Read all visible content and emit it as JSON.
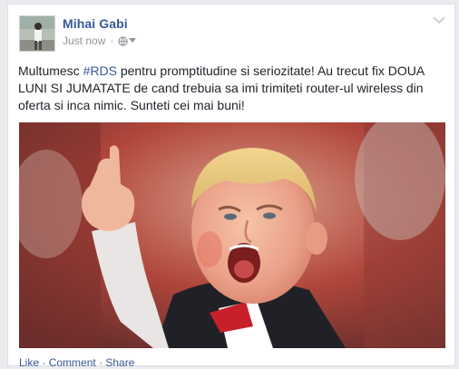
{
  "post": {
    "author": "Mihai Gabi",
    "timestamp": "Just now",
    "separator": "·",
    "audience_icon": "globe-icon",
    "menu_icon": "chevron-down-icon",
    "text_before": "Multumesc ",
    "hashtag": "#RDS",
    "text_after": " pentru promptitudine si seriozitate! Au trecut fix DOUA LUNI SI JUMATATE de cand trebuia sa imi trimiteti router-ul wireless din oferta si inca nimic. Sunteti cei mai buni!",
    "actions": [
      "Like",
      "Comment",
      "Share"
    ],
    "action_separator": " · "
  },
  "colors": {
    "link": "#365899",
    "text": "#1d2129",
    "meta": "#90949c",
    "background": "#e9ebee"
  }
}
